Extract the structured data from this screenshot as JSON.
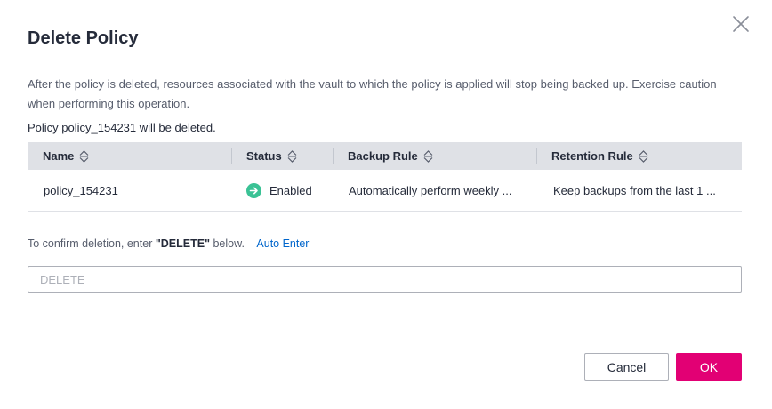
{
  "dialog": {
    "title": "Delete Policy",
    "warning": "After the policy is deleted, resources associated with the vault to which the policy is applied will stop being backed up. Exercise caution when performing this operation.",
    "notice": "Policy policy_154231 will be deleted."
  },
  "table": {
    "headers": {
      "name": "Name",
      "status": "Status",
      "backup_rule": "Backup Rule",
      "retention_rule": "Retention Rule"
    },
    "rows": [
      {
        "name": "policy_154231",
        "status": "Enabled",
        "backup_rule": "Automatically perform weekly ...",
        "retention_rule": "Keep backups from the last 1 ..."
      }
    ]
  },
  "confirm": {
    "prefix": "To confirm deletion, enter ",
    "keyword": "\"DELETE\"",
    "suffix": " below.",
    "auto_enter": "Auto Enter",
    "input_value": "",
    "input_placeholder": "DELETE"
  },
  "buttons": {
    "cancel": "Cancel",
    "ok": "OK"
  },
  "colors": {
    "primary": "#e20074",
    "link": "#0066cc",
    "status_enabled": "#3ac295",
    "header_bg": "#dfe1e6"
  },
  "icons": {
    "close": "close-icon",
    "sort": "sort-icon",
    "status": "arrow-right-circle-icon"
  }
}
